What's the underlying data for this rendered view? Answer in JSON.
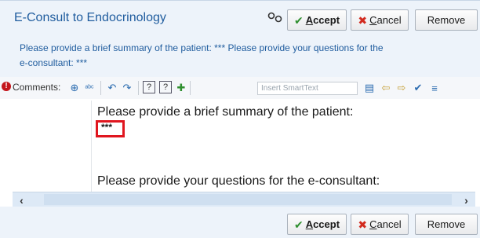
{
  "section": {
    "title": "E-Consult to Endocrinology",
    "prompt": "Please provide a brief summary of the patient: *** Please provide your questions for the e-consultant: ***"
  },
  "buttons": {
    "accept_label_hotkey": "A",
    "accept_label_rest": "ccept",
    "cancel_label_hotkey": "C",
    "cancel_label_rest": "ancel",
    "remove_label": "Remove"
  },
  "toolbar": {
    "comments_label": "Comments:",
    "smarttext_placeholder": "Insert SmartText"
  },
  "editor": {
    "line1": "Please provide a brief summary of the patient:",
    "placeholder_stars": "***",
    "line2": "Please provide your questions for the e-consultant:"
  },
  "colors": {
    "accent": "#1f5c9e",
    "highlight_border": "#e0161f",
    "accept_check": "#2f8f2f",
    "cancel_x": "#d22a1e"
  },
  "icons": [
    "link-icon",
    "check-icon",
    "close-icon",
    "warning-icon",
    "spell-check-icon",
    "undo-icon",
    "redo-icon",
    "help-icon",
    "add-icon",
    "left-arrow-icon",
    "right-arrow-icon",
    "chevron-left-icon",
    "chevron-right-icon"
  ]
}
